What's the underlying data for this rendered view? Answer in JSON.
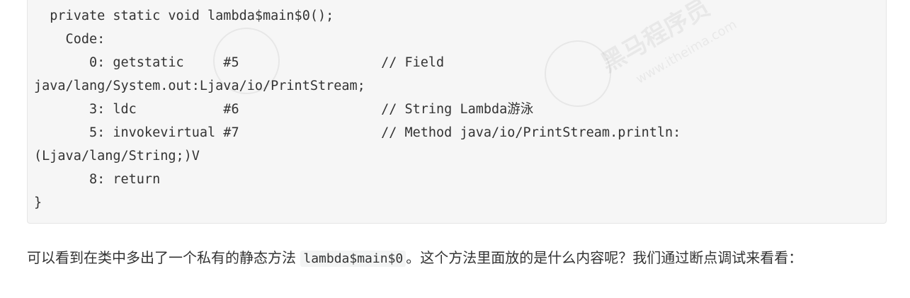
{
  "code_block": {
    "lines": [
      "  private static void lambda$main$0();",
      "    Code:",
      "       0: getstatic     #5                  // Field",
      "java/lang/System.out:Ljava/io/PrintStream;",
      "       3: ldc           #6                  // String Lambda游泳",
      "       5: invokevirtual #7                  // Method java/io/PrintStream.println:",
      "(Ljava/lang/String;)V",
      "       8: return",
      "}"
    ]
  },
  "paragraph": {
    "text_before": "可以看到在类中多出了一个私有的静态方法 ",
    "inline_code": "lambda$main$0",
    "text_after": "。这个方法里面放的是什么内容呢？我们通过断点调试来看看："
  },
  "watermark": {
    "brand": "黑马程序员",
    "url": "www.itheima.com"
  }
}
